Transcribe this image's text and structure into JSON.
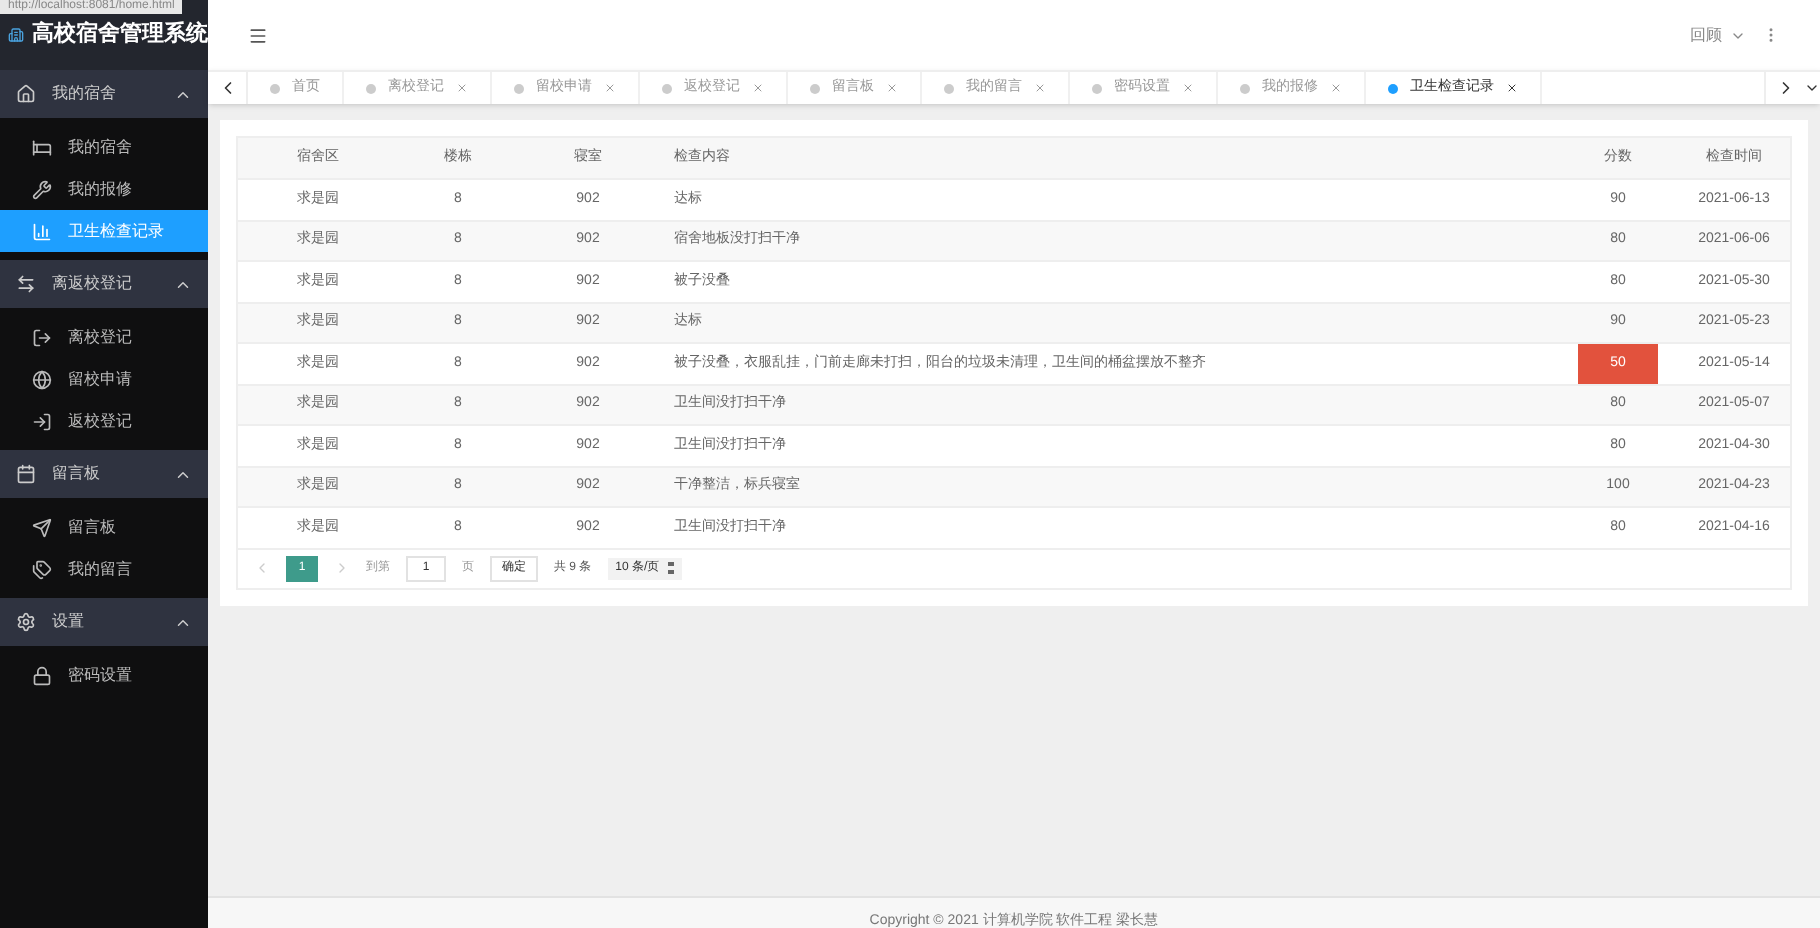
{
  "browser_url": "http://localhost:8081/home.html",
  "app_title": "高校宿舍管理系统",
  "sidebar": {
    "groups": [
      {
        "label": "我的宿舍",
        "expanded": true,
        "items": [
          {
            "label": "我的宿舍",
            "selected": false
          },
          {
            "label": "我的报修",
            "selected": false
          },
          {
            "label": "卫生检查记录",
            "selected": true
          }
        ]
      },
      {
        "label": "离返校登记",
        "expanded": true,
        "items": [
          {
            "label": "离校登记",
            "selected": false
          },
          {
            "label": "留校申请",
            "selected": false
          },
          {
            "label": "返校登记",
            "selected": false
          }
        ]
      },
      {
        "label": "留言板",
        "expanded": true,
        "items": [
          {
            "label": "留言板",
            "selected": false
          },
          {
            "label": "我的留言",
            "selected": false
          }
        ]
      },
      {
        "label": "设置",
        "expanded": true,
        "items": [
          {
            "label": "密码设置",
            "selected": false
          }
        ]
      }
    ]
  },
  "user_menu": "回顾",
  "tabs": [
    {
      "label": "首页",
      "closable": false,
      "selected": false
    },
    {
      "label": "离校登记",
      "closable": true,
      "selected": false
    },
    {
      "label": "留校申请",
      "closable": true,
      "selected": false
    },
    {
      "label": "返校登记",
      "closable": true,
      "selected": false
    },
    {
      "label": "留言板",
      "closable": true,
      "selected": false
    },
    {
      "label": "我的留言",
      "closable": true,
      "selected": false
    },
    {
      "label": "密码设置",
      "closable": true,
      "selected": false
    },
    {
      "label": "我的报修",
      "closable": true,
      "selected": false
    },
    {
      "label": "卫生检查记录",
      "closable": true,
      "selected": true
    }
  ],
  "table": {
    "columns": [
      "宿舍区",
      "楼栋",
      "寝室",
      "检查内容",
      "分数",
      "检查时间"
    ],
    "rows": [
      {
        "cells": [
          "求是园",
          "8",
          "902",
          "达标",
          "90",
          "2021-06-13"
        ],
        "low_score": false
      },
      {
        "cells": [
          "求是园",
          "8",
          "902",
          "宿舍地板没打扫干净",
          "80",
          "2021-06-06"
        ],
        "low_score": false
      },
      {
        "cells": [
          "求是园",
          "8",
          "902",
          "被子没叠",
          "80",
          "2021-05-30"
        ],
        "low_score": false
      },
      {
        "cells": [
          "求是园",
          "8",
          "902",
          "达标",
          "90",
          "2021-05-23"
        ],
        "low_score": false
      },
      {
        "cells": [
          "求是园",
          "8",
          "902",
          "被子没叠，衣服乱挂，门前走廊未打扫，阳台的垃圾未清理，卫生间的桶盆摆放不整齐",
          "50",
          "2021-05-14"
        ],
        "low_score": true
      },
      {
        "cells": [
          "求是园",
          "8",
          "902",
          "卫生间没打扫干净",
          "80",
          "2021-05-07"
        ],
        "low_score": false
      },
      {
        "cells": [
          "求是园",
          "8",
          "902",
          "卫生间没打扫干净",
          "80",
          "2021-04-30"
        ],
        "low_score": false
      },
      {
        "cells": [
          "求是园",
          "8",
          "902",
          "干净整洁，标兵寝室",
          "100",
          "2021-04-23"
        ],
        "low_score": false
      },
      {
        "cells": [
          "求是园",
          "8",
          "902",
          "卫生间没打扫干净",
          "80",
          "2021-04-16"
        ],
        "low_score": false
      }
    ]
  },
  "pagination": {
    "current_page": "1",
    "goto_label": "到第",
    "goto_value": "1",
    "page_unit": "页",
    "confirm": "确定",
    "total": "共 9 条",
    "page_size": "10 条/页"
  },
  "footer": "Copyright © 2021 计算机学院 软件工程 梁长慧"
}
